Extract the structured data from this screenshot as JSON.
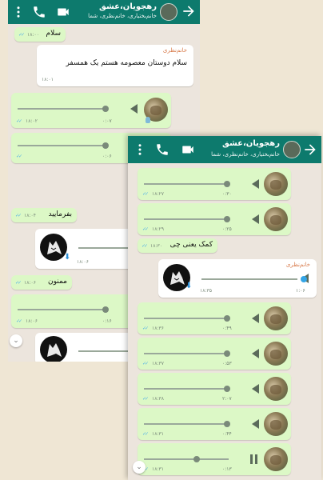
{
  "chat1": {
    "title": "رهجویان،عشق",
    "subtitle": "خانم‌بختیاری، خانم‌نظری، شما",
    "messages": [
      {
        "kind": "text",
        "text": "سلام",
        "time": "۱۸:۰۰"
      },
      {
        "kind": "text_in",
        "sender": "خانم‌نظری",
        "text": "سلام دوستان معصومه هستم یک همسفر",
        "time": "۱۸:۰۱"
      },
      {
        "kind": "voice",
        "duration": "۰:۰۷",
        "time": "۱۸:۰۲"
      },
      {
        "kind": "voice",
        "duration": "۰:۰۶",
        "time": ""
      },
      {
        "kind": "text",
        "text": "بفرمایید",
        "time": "۱۸:۰۴"
      },
      {
        "kind": "voice_in",
        "time": "۱۸:۰۶"
      },
      {
        "kind": "text",
        "text": "ممنون",
        "time": "۱۸:۰۶"
      },
      {
        "kind": "voice",
        "duration": "۰:۱۶",
        "time": "۱۸:۰۶"
      },
      {
        "kind": "voice_in",
        "time": ""
      }
    ]
  },
  "chat2": {
    "title": "رهجویان،عشق",
    "subtitle": "خانم‌بختیاری، خانم‌نظری، شما",
    "messages": [
      {
        "kind": "voice",
        "duration": "۰:۳۰",
        "time": "۱۸:۲۷"
      },
      {
        "kind": "voice",
        "duration": "۰:۲۵",
        "time": "۱۸:۲۹"
      },
      {
        "kind": "text",
        "text": "کمک یعنی چی",
        "time": "۱۸:۳۰"
      },
      {
        "kind": "voice_in",
        "sender": "خانم‌نظری",
        "duration": "۱:۰۶",
        "time": "۱۸:۳۵"
      },
      {
        "kind": "voice",
        "duration": "۰:۴۹",
        "time": "۱۸:۳۶"
      },
      {
        "kind": "voice",
        "duration": "۰:۵۳",
        "time": "۱۸:۳۷"
      },
      {
        "kind": "voice",
        "duration": "۲:۰۷",
        "time": "۱۸:۳۸"
      },
      {
        "kind": "voice",
        "duration": "۰:۴۴",
        "time": "۱۸:۳۱"
      },
      {
        "kind": "voice_playing",
        "duration": "۰:۱۳",
        "time": "۱۸:۳۱"
      }
    ]
  },
  "colors": {
    "header": "#0d7a6d",
    "outgoing": "#dcf8c6",
    "incoming": "#ffffff",
    "background": "#ece5dd"
  }
}
